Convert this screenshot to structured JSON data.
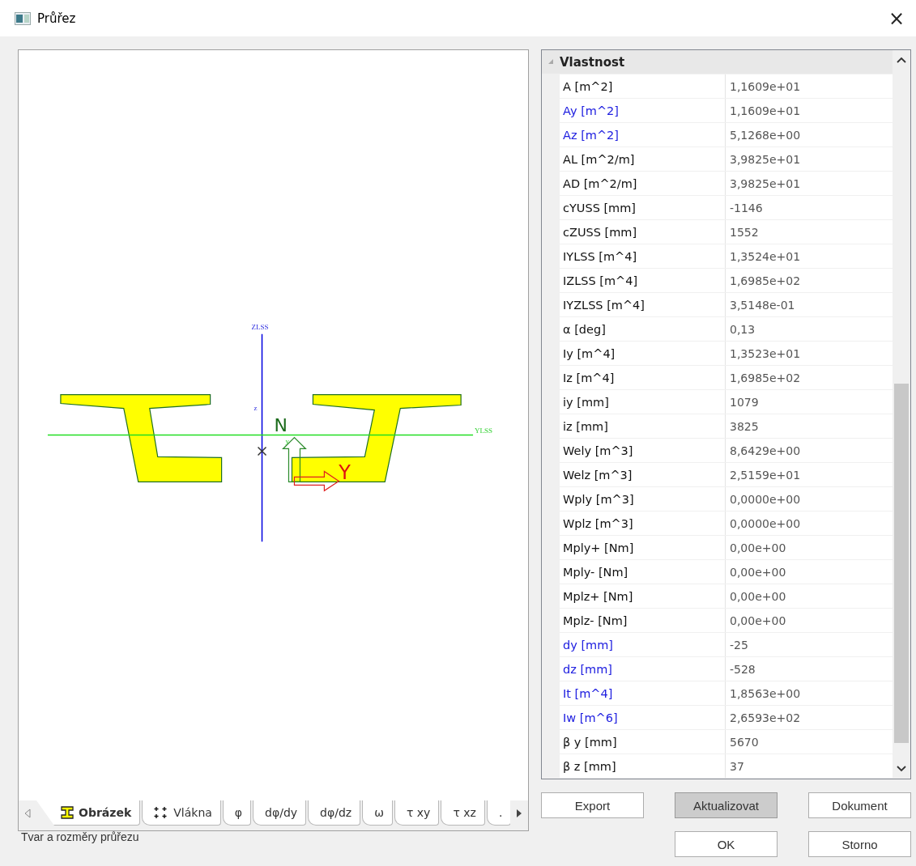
{
  "window": {
    "title": "Průřez",
    "close": "×"
  },
  "canvas": {
    "labels": {
      "z_axis": "ZLSS",
      "y_axis": "YLSS",
      "z_small": "z",
      "y_small": "y",
      "arrow_n": "N",
      "arrow_y": "Y"
    }
  },
  "tabs": [
    {
      "label": "Obrázek",
      "kind": "beam",
      "selected": true
    },
    {
      "label": "Vlákna",
      "kind": "fibers",
      "selected": false
    },
    {
      "label": "φ",
      "selected": false
    },
    {
      "label": "dφ/dy",
      "selected": false
    },
    {
      "label": "dφ/dz",
      "selected": false
    },
    {
      "label": "ω",
      "selected": false
    },
    {
      "label": "τ xy",
      "selected": false
    },
    {
      "label": "τ xz",
      "selected": false
    },
    {
      "label": ".",
      "selected": false
    }
  ],
  "status_text": "Tvar a rozměry průřezu",
  "properties": {
    "header": "Vlastnost",
    "rows": [
      {
        "name": "A [m^2]",
        "value": "1,1609e+01",
        "highlighted": false
      },
      {
        "name": "Ay [m^2]",
        "value": "1,1609e+01",
        "highlighted": true
      },
      {
        "name": "Az [m^2]",
        "value": "5,1268e+00",
        "highlighted": true
      },
      {
        "name": "AL [m^2/m]",
        "value": "3,9825e+01",
        "highlighted": false
      },
      {
        "name": "AD [m^2/m]",
        "value": "3,9825e+01",
        "highlighted": false
      },
      {
        "name": "cYUSS [mm]",
        "value": "-1146",
        "highlighted": false
      },
      {
        "name": "cZUSS [mm]",
        "value": "1552",
        "highlighted": false
      },
      {
        "name": "IYLSS [m^4]",
        "value": "1,3524e+01",
        "highlighted": false
      },
      {
        "name": "IZLSS [m^4]",
        "value": "1,6985e+02",
        "highlighted": false
      },
      {
        "name": "IYZLSS [m^4]",
        "value": "3,5148e-01",
        "highlighted": false
      },
      {
        "name": "α [deg]",
        "value": "0,13",
        "highlighted": false
      },
      {
        "name": "Iy [m^4]",
        "value": "1,3523e+01",
        "highlighted": false
      },
      {
        "name": "Iz [m^4]",
        "value": "1,6985e+02",
        "highlighted": false
      },
      {
        "name": "iy [mm]",
        "value": "1079",
        "highlighted": false
      },
      {
        "name": "iz [mm]",
        "value": "3825",
        "highlighted": false
      },
      {
        "name": "Wely [m^3]",
        "value": "8,6429e+00",
        "highlighted": false
      },
      {
        "name": "Welz [m^3]",
        "value": "2,5159e+01",
        "highlighted": false
      },
      {
        "name": "Wply [m^3]",
        "value": "0,0000e+00",
        "highlighted": false
      },
      {
        "name": "Wplz [m^3]",
        "value": "0,0000e+00",
        "highlighted": false
      },
      {
        "name": "Mply+ [Nm]",
        "value": "0,00e+00",
        "highlighted": false
      },
      {
        "name": "Mply- [Nm]",
        "value": "0,00e+00",
        "highlighted": false
      },
      {
        "name": "Mplz+ [Nm]",
        "value": "0,00e+00",
        "highlighted": false
      },
      {
        "name": "Mplz- [Nm]",
        "value": "0,00e+00",
        "highlighted": false
      },
      {
        "name": "dy [mm]",
        "value": "-25",
        "highlighted": true
      },
      {
        "name": "dz [mm]",
        "value": "-528",
        "highlighted": true
      },
      {
        "name": "It [m^4]",
        "value": "1,8563e+00",
        "highlighted": true
      },
      {
        "name": "Iw [m^6]",
        "value": "2,6593e+02",
        "highlighted": true
      },
      {
        "name": "β y [mm]",
        "value": "5670",
        "highlighted": false
      },
      {
        "name": "β z [mm]",
        "value": "37",
        "highlighted": false
      }
    ]
  },
  "buttons": [
    {
      "label": "Export",
      "pressed": false
    },
    {
      "label": "Aktualizovat",
      "pressed": true
    },
    {
      "label": "Dokument",
      "pressed": false
    },
    {
      "label": "OK",
      "pressed": false
    },
    {
      "label": "Storno",
      "pressed": false
    }
  ]
}
